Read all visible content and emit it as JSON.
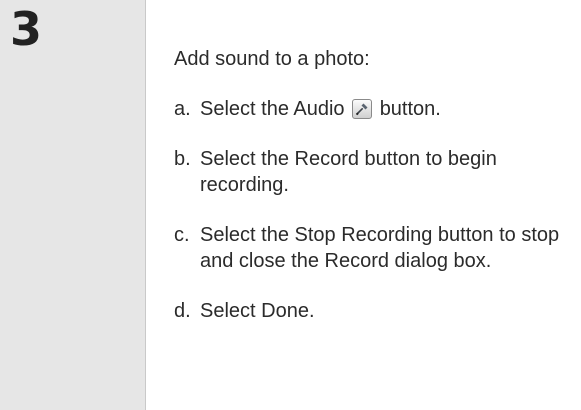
{
  "step": {
    "number": "3"
  },
  "instructions": {
    "intro": "Add sound to a photo:",
    "items": [
      {
        "marker": "a.",
        "before_icon": "Select the Audio",
        "icon": "microphone-icon",
        "after_icon": "button."
      },
      {
        "marker": "b.",
        "text": "Select the Record button to begin recording."
      },
      {
        "marker": "c.",
        "text": "Select the Stop Recording button to stop and close the Record dialog box."
      },
      {
        "marker": "d.",
        "text": "Select Done."
      }
    ]
  }
}
